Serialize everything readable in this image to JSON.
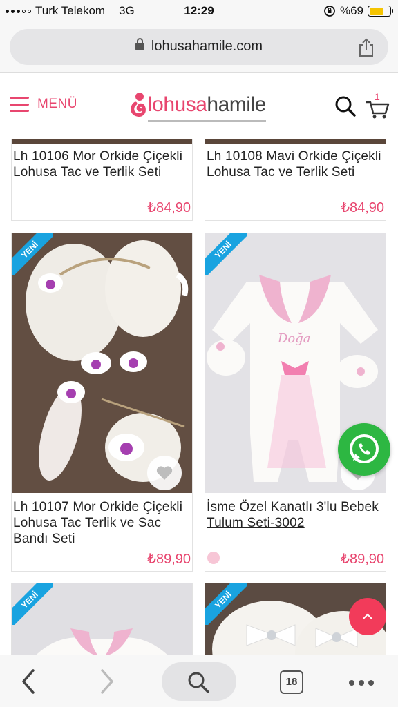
{
  "status_bar": {
    "carrier": "Turk Telekom",
    "network": "3G",
    "time": "12:29",
    "battery_percent": "%69",
    "battery_level": 0.69
  },
  "browser": {
    "url": "lohusahamile.com"
  },
  "header": {
    "menu_label": "MENÜ",
    "logo_part1": "lohusa",
    "logo_part2": "hamile",
    "cart_count": "1",
    "brand_color": "#e8466f"
  },
  "products": [
    {
      "title": "Lh 10106 Mor Orkide Çiçekli Lohusa Tac ve Terlik Seti",
      "price": "₺84,90",
      "badge": ""
    },
    {
      "title": "Lh 10108 Mavi Orkide Çiçekli Lohusa Tac ve Terlik Seti",
      "price": "₺84,90",
      "badge": ""
    },
    {
      "title": "Lh 10107 Mor Orkide Çiçekli Lohusa Tac Terlik ve Sac Bandı Seti",
      "price": "₺89,90",
      "badge": "YENİ"
    },
    {
      "title": "İsme Özel Kanatlı 3'lu Bebek Tulum Seti-3002",
      "price": "₺89,90",
      "badge": "YENİ",
      "image_text": "Doğa"
    },
    {
      "title": "",
      "price": "",
      "badge": "YENİ"
    },
    {
      "title": "",
      "price": "",
      "badge": "YENİ"
    }
  ],
  "bottom_bar": {
    "tab_count": "18"
  }
}
